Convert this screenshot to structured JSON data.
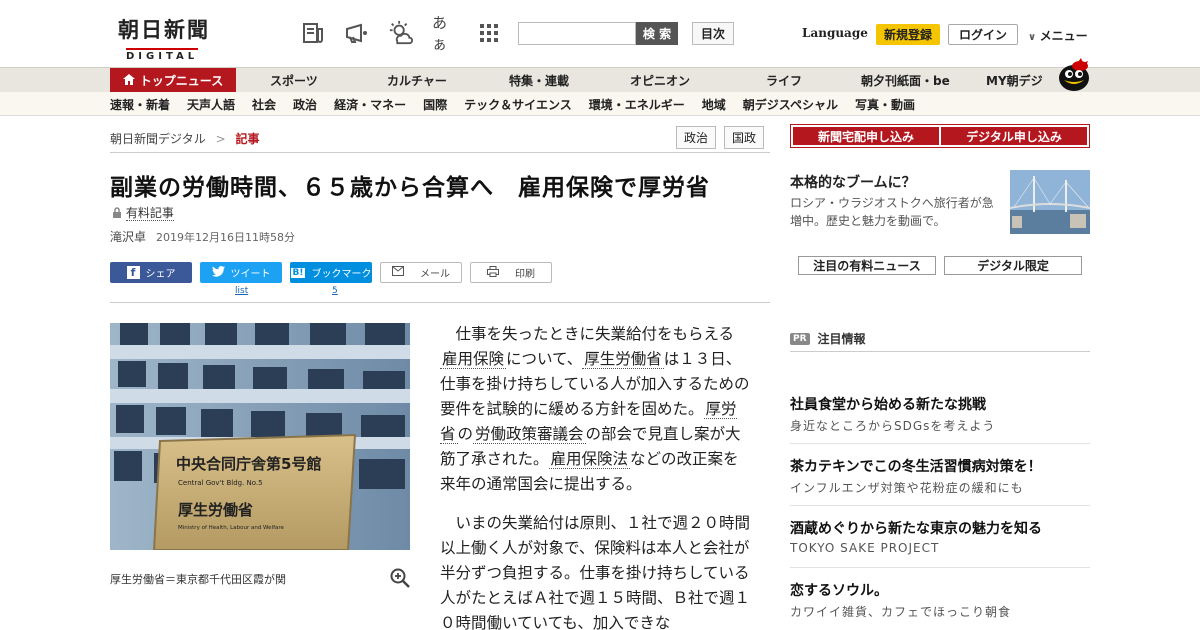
{
  "header": {
    "logo_ja": "朝日新聞",
    "logo_en": "DIGITAL",
    "icons": [
      "newspaper-icon",
      "megaphone-icon",
      "weather-icon",
      "font-size-icon",
      "grid-icon"
    ],
    "font_size_label": "あぁ",
    "search_placeholder": "",
    "search_label": "検 索",
    "toc_label": "目次",
    "language_label": "Language",
    "signup_label": "新規登録",
    "login_label": "ログイン",
    "menu_label": "メニュー"
  },
  "nav_primary": [
    {
      "label": "トップニュース",
      "active": true
    },
    {
      "label": "スポーツ"
    },
    {
      "label": "カルチャー"
    },
    {
      "label": "特集・連載"
    },
    {
      "label": "オピニオン"
    },
    {
      "label": "ライフ"
    },
    {
      "label": "朝夕刊紙面・be"
    },
    {
      "label": "MY朝デジ"
    }
  ],
  "nav_secondary": [
    "速報・新着",
    "天声人語",
    "社会",
    "政治",
    "経済・マネー",
    "国際",
    "テック＆サイエンス",
    "環境・エネルギー",
    "地域",
    "朝デジスペシャル",
    "写真・動画"
  ],
  "breadcrumb": {
    "home": "朝日新聞デジタル",
    "sep": ">",
    "current": "記事"
  },
  "tags": [
    "政治",
    "国政"
  ],
  "article": {
    "title": "副業の労働時間、６５歳から合算へ　雇用保険で厚労省",
    "paid_label": "有料記事",
    "author": "滝沢卓",
    "date": "2019年12月16日11時58分",
    "photo_caption": "厚生労働省＝東京都千代田区霞が関",
    "photo_sign_ja1": "中央合同庁舎第5号館",
    "photo_sign_en1": "Central Gov't Bldg. No.5",
    "photo_sign_ja2": "厚生労働省",
    "photo_sign_en2": "Ministry of Health, Labour and Welfare",
    "p1": {
      "t1": "仕事を失ったときに失業給付をもらえる",
      "k1": "雇用保険",
      "t2": "について、",
      "k2": "厚生労働省",
      "t3": "は１３日、仕事を掛け持ちしている人が加入するための要件を試験的に緩める方針を固めた。",
      "k3": "厚労省",
      "t4": "の",
      "k4": "労働政策審議会",
      "t5": "の部会で見直し案が大筋了承された。",
      "k5": "雇用保険法",
      "t6": "などの改正案を来年の通常国会に提出する。"
    },
    "p2": "いまの失業給付は原則、１社で週２０時間以上働く人が対象で、保険料は本人と会社が半分ずつ負担する。仕事を掛け持ちしている人がたとえばＡ社で週１５時間、Ｂ社で週１０時間働いていても、加入できな"
  },
  "share": {
    "facebook": "シェア",
    "twitter": "ツイート",
    "twitter_count": "list",
    "hatena": "ブックマーク",
    "hatena_count": "5",
    "mail": "メール",
    "print": "印刷"
  },
  "sidebar": {
    "btn_paper": "新聞宅配申し込み",
    "btn_digital": "デジタル申し込み",
    "promo_title": "本格的なブームに？",
    "promo_text": "ロシア・ウラジオストクへ旅行者が急増中。歴史と魅力を動画で。",
    "tab1": "注目の有料ニュース",
    "tab2": "デジタル限定",
    "pr_badge": "PR",
    "pr_title": "注目情報",
    "ads": [
      {
        "title": "社員食堂から始める新たな挑戦",
        "sub": "身近なところからSDGsを考えよう"
      },
      {
        "title": "茶カテキンでこの冬生活習慣病対策を！",
        "sub": "インフルエンザ対策や花粉症の緩和にも"
      },
      {
        "title": "酒蔵めぐりから新たな東京の魅力を知る",
        "sub": "TOKYO SAKE PROJECT"
      },
      {
        "title": "恋するソウル。",
        "sub": "カワイイ雑貨、カフェでほっこり朝食"
      }
    ]
  },
  "colors": {
    "brand_red": "#b5171e",
    "signup_yellow": "#f5c600",
    "facebook": "#3b5998",
    "twitter": "#1da1f2",
    "hatena": "#008fde"
  }
}
